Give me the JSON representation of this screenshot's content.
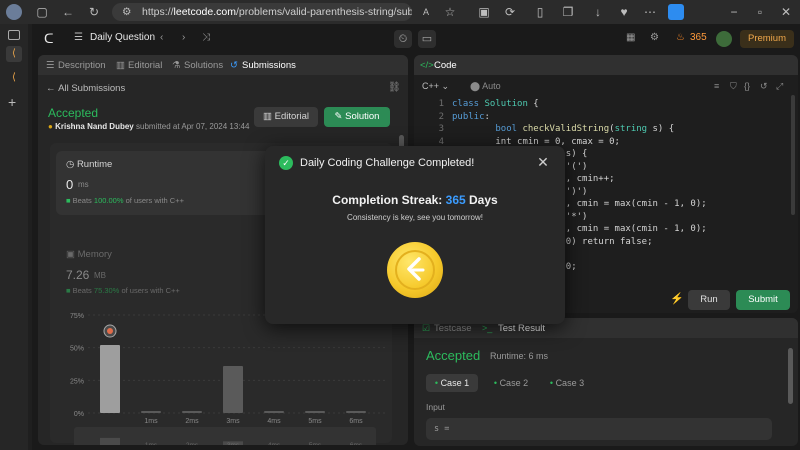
{
  "browser": {
    "url_prefix": "https://",
    "url_host": "leetcode.com",
    "url_path": "/problems/valid-parenthesis-string/submission..."
  },
  "nav": {
    "daily_question": "Daily Question",
    "streak_count": "365",
    "premium_label": "Premium"
  },
  "left": {
    "tabs": [
      "Description",
      "Editorial",
      "Solutions",
      "Submissions"
    ],
    "all_submissions": "All Submissions",
    "status": "Accepted",
    "author": "Krishna Nand Dubey",
    "submitted_text": "submitted at Apr 07, 2024 13:44",
    "editorial_btn": "Editorial",
    "solution_btn": "Solution",
    "runtime_label": "Runtime",
    "runtime_value": "0",
    "runtime_unit": "ms",
    "runtime_beats_prefix": "Beats",
    "runtime_beats_pct": "100.00%",
    "runtime_beats_suffix": "of users with C++",
    "memory_label": "Memory",
    "memory_value": "7.26",
    "memory_unit": "MB",
    "memory_beats_prefix": "Beats",
    "memory_beats_pct": "75.30%",
    "memory_beats_suffix": "of users with C++"
  },
  "chart_data": {
    "type": "bar",
    "title": "",
    "xlabel": "",
    "ylabel": "",
    "categories": [
      "0ms",
      "1ms",
      "2ms",
      "3ms",
      "4ms",
      "5ms",
      "6ms"
    ],
    "values": [
      52,
      1,
      1,
      36,
      1,
      1,
      1
    ],
    "ytick_labels": [
      "75%",
      "50%",
      "25%",
      "0%"
    ],
    "ylim": [
      0,
      75
    ],
    "highlight_index": 0
  },
  "code": {
    "header": "Code",
    "language": "C++",
    "auto_label": "Auto",
    "lines": [
      {
        "n": "1",
        "parts": [
          [
            "kw",
            "class "
          ],
          [
            "ty",
            "Solution "
          ],
          [
            "",
            "{"
          ]
        ]
      },
      {
        "n": "2",
        "parts": [
          [
            "kw",
            "public"
          ],
          [
            "",
            ":"
          ]
        ]
      },
      {
        "n": "3",
        "parts": [
          [
            "",
            "        "
          ],
          [
            "kw",
            "bool "
          ],
          [
            "fn",
            "checkValidString"
          ],
          [
            "",
            "("
          ],
          [
            "ty",
            "string "
          ],
          [
            "",
            "s) {"
          ]
        ]
      },
      {
        "n": "4",
        "parts": [
          [
            "",
            "        int cmin = 0, cmax = 0;"
          ]
        ]
      },
      {
        "n": "5",
        "parts": [
          [
            "",
            "                     s) {"
          ]
        ]
      },
      {
        "n": "6",
        "parts": [
          [
            "",
            "                     '(')"
          ]
        ]
      },
      {
        "n": "7",
        "parts": [
          [
            "",
            "                     , cmin++;"
          ]
        ]
      },
      {
        "n": "8",
        "parts": [
          [
            "",
            "                     ')')"
          ]
        ]
      },
      {
        "n": "9",
        "parts": [
          [
            "",
            "                     , cmin = max(cmin - 1, 0);"
          ]
        ]
      },
      {
        "n": "10",
        "parts": [
          [
            "",
            "                     '*')"
          ]
        ]
      },
      {
        "n": "11",
        "parts": [
          [
            "",
            "                     , cmin = max(cmin - 1, 0);"
          ]
        ]
      },
      {
        "n": "12",
        "parts": [
          [
            "",
            "                     0) return false;"
          ]
        ]
      },
      {
        "n": "13",
        "parts": [
          [
            "",
            ""
          ]
        ]
      },
      {
        "n": "14",
        "parts": [
          [
            "",
            "                     0;"
          ]
        ]
      }
    ],
    "run_btn": "Run",
    "submit_btn": "Submit"
  },
  "result": {
    "tabs": [
      "Testcase",
      "Test Result"
    ],
    "status": "Accepted",
    "runtime": "Runtime: 6 ms",
    "cases": [
      "Case 1",
      "Case 2",
      "Case 3"
    ],
    "input_label": "Input",
    "input_value": "s ="
  },
  "modal": {
    "title": "Daily Coding Challenge Completed!",
    "streak_label": "Completion Streak:",
    "streak_value": "365",
    "streak_unit": "Days",
    "subtitle": "Consistency is key, see you tomorrow!"
  },
  "colors": {
    "accent_green": "#2cbb5d",
    "streak_blue": "#3b9cff",
    "premium_orange": "#f0a84b",
    "coin_gold": "#f6c92b"
  }
}
